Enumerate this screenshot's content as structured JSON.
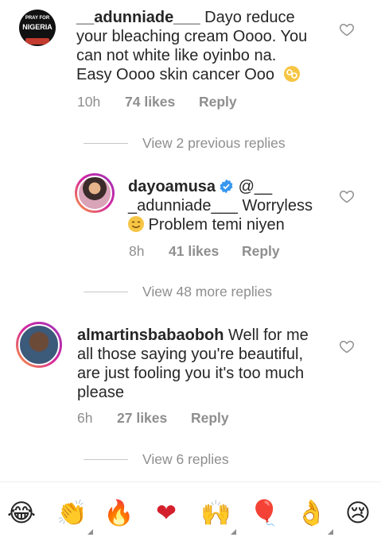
{
  "comments": [
    {
      "username": "__adunniade___",
      "text_line1": " Dayo reduce",
      "text_line2": "your bleaching cream Oooo. You",
      "text_line3": "can not white like oyinbo na.",
      "text_line4": "Easy Oooo skin cancer Ooo",
      "time": "10h",
      "likes": "74 likes",
      "reply": "Reply",
      "avatar_text_top": "PRAY FOR",
      "avatar_text_main": "NIGERIA"
    },
    {
      "username": "dayoamusa",
      "mention": " @__",
      "text_line2": "_adunniade___ Worryless",
      "text_line3": " Problem temi niyen",
      "time": "8h",
      "likes": "41 likes",
      "reply": "Reply"
    },
    {
      "username": "almartinsbabaoboh",
      "text_line1": " Well for me",
      "text_line2": "all those saying you're beautiful,",
      "text_line3": "are just fooling you it's too much",
      "text_line4": "please",
      "time": "6h",
      "likes": "27 likes",
      "reply": "Reply"
    }
  ],
  "view_replies": {
    "first": "View 2 previous replies",
    "second": "View 48 more replies",
    "third": "View 6 replies"
  },
  "emoji_bar": [
    "😂",
    "👏",
    "🔥",
    "❤",
    "🙌",
    "🎈",
    "👌",
    "😢"
  ],
  "colors": {
    "text": "#262626",
    "secondary": "#8e8e8e",
    "verified": "#3897f0",
    "heart_color": "#ed4956"
  }
}
